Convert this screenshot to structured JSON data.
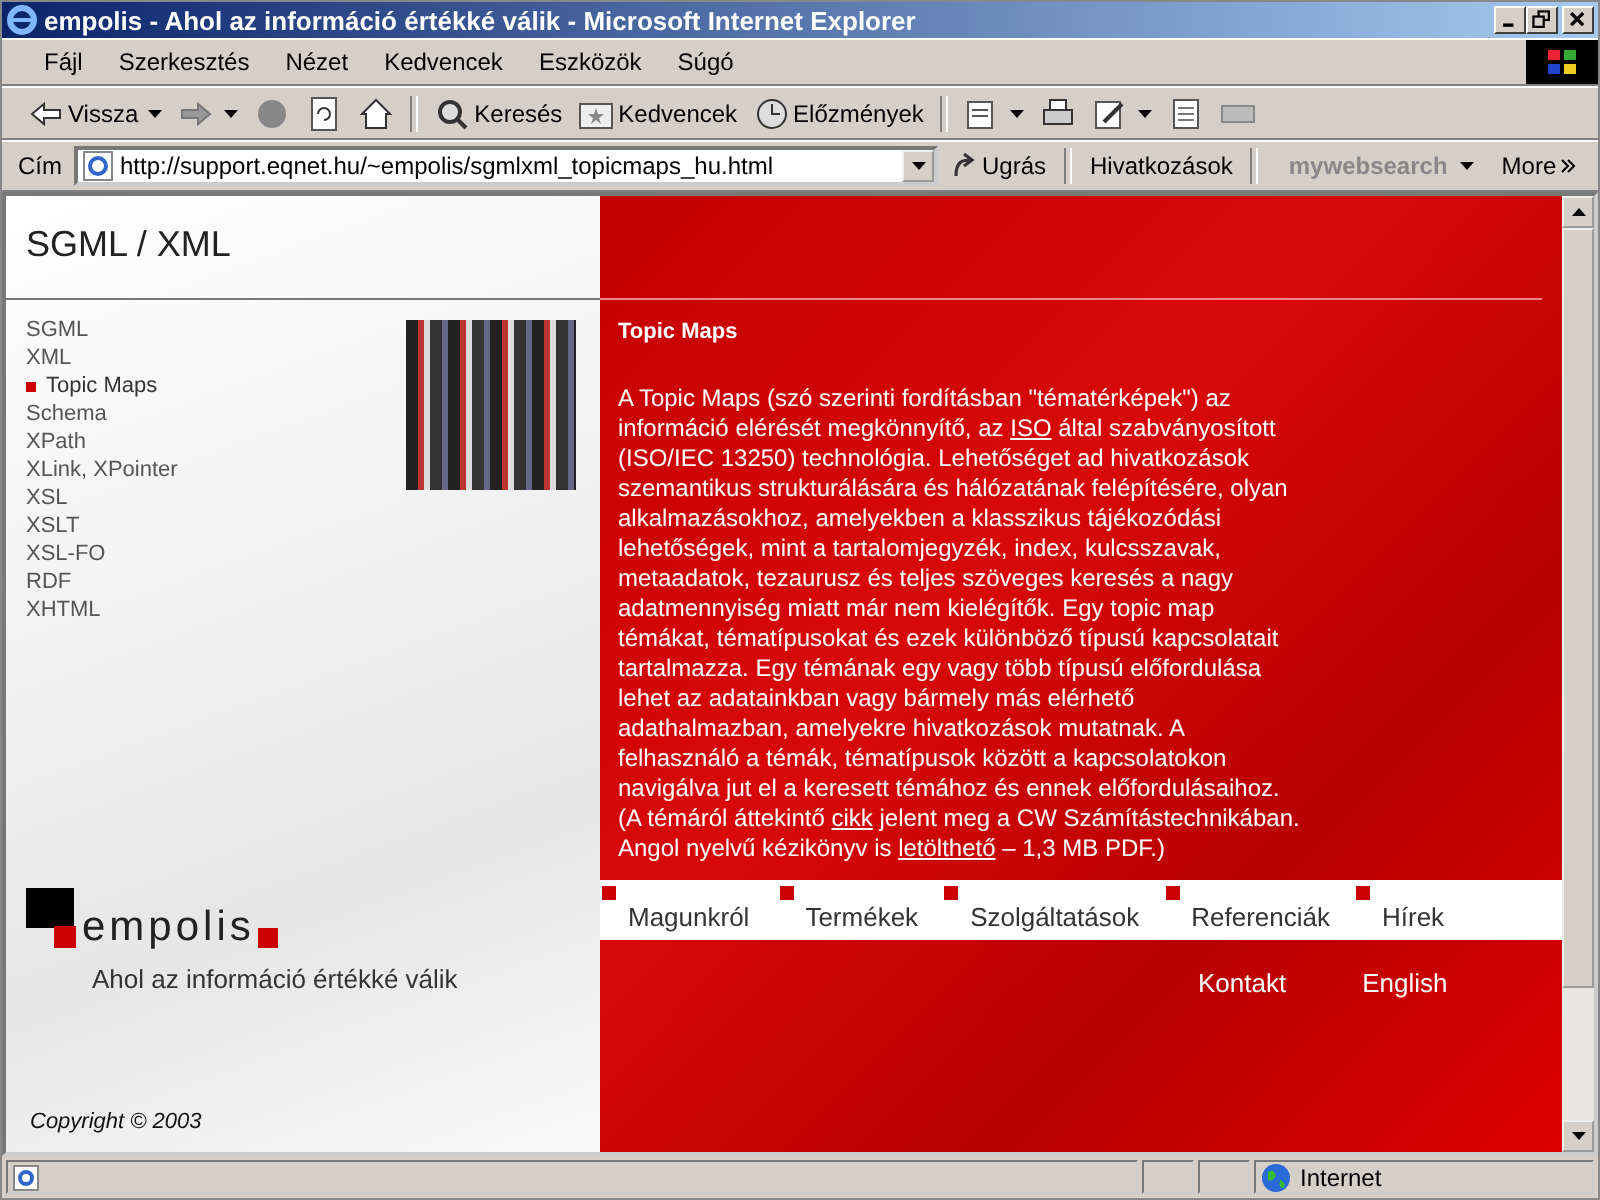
{
  "window": {
    "title": "empolis - Ahol az információ értékké válik - Microsoft Internet Explorer"
  },
  "menu": [
    "Fájl",
    "Szerkesztés",
    "Nézet",
    "Kedvencek",
    "Eszközök",
    "Súgó"
  ],
  "toolbar": [
    {
      "kind": "back",
      "label": "Vissza"
    },
    {
      "kind": "forward"
    },
    {
      "kind": "stop"
    },
    {
      "kind": "refresh"
    },
    {
      "kind": "home"
    },
    {
      "kind": "search",
      "label": "Keresés"
    },
    {
      "kind": "favorites",
      "label": "Kedvencek"
    },
    {
      "kind": "history",
      "label": "Előzmények"
    },
    {
      "kind": "mail"
    },
    {
      "kind": "print"
    },
    {
      "kind": "edit"
    },
    {
      "kind": "discuss"
    },
    {
      "kind": "messenger"
    }
  ],
  "address": {
    "label": "Cím",
    "value": "http://support.eqnet.hu/~empolis/sgmlxml_topicmaps_hu.html",
    "go": "Ugrás",
    "links": "Hivatkozások",
    "websearch": "my**web**search",
    "more": "More"
  },
  "page": {
    "heading": "SGML / XML",
    "nav": [
      {
        "label": "SGML",
        "selected": false
      },
      {
        "label": "XML",
        "selected": false
      },
      {
        "label": "Topic Maps",
        "selected": true
      },
      {
        "label": "Schema",
        "selected": false
      },
      {
        "label": "XPath",
        "selected": false
      },
      {
        "label": "XLink, XPointer",
        "selected": false
      },
      {
        "label": "XSL",
        "selected": false
      },
      {
        "label": "XSLT",
        "selected": false
      },
      {
        "label": "XSL-FO",
        "selected": false
      },
      {
        "label": "RDF",
        "selected": false
      },
      {
        "label": "XHTML",
        "selected": false
      }
    ],
    "article_title": "Topic Maps",
    "paragraphs": [
      [
        {
          "kind": "text",
          "text": "A Topic Maps (szó szerinti fordításban \"tématérképek\") az információ elérését megkönnyítő, az "
        },
        {
          "kind": "link",
          "text": "ISO"
        },
        {
          "kind": "text",
          "text": " által szabványosított (ISO/IEC 13250) technológia. Lehetőséget ad hivatkozások szemantikus strukturálására és hálózatának felépítésére, olyan alkalmazásokhoz, amelyekben a klasszikus tájékozódási lehetőségek, mint a tartalomjegyzék, index, kulcsszavak, metaadatok, tezaurusz és teljes szöveges keresés a nagy adatmennyiség miatt már nem kielégítők. Egy topic map témákat, tématípusokat és ezek különböző típusú kapcsolatait tartalmazza. Egy témának egy vagy több típusú előfordulása lehet az adatainkban vagy bármely más elérhető adathalmazban, amelyekre hivatkozások mutatnak. A felhasználó a témák, tématípusok között a kapcsolatokon navigálva jut el a keresett témához és ennek előfordulásaihoz."
        }
      ],
      [
        {
          "kind": "text",
          "text": "(A témáról áttekintő "
        },
        {
          "kind": "link",
          "text": "cikk"
        },
        {
          "kind": "text",
          "text": " jelent meg a CW Számítástechnikában. Angol nyelvű kézikönyv is "
        },
        {
          "kind": "link",
          "text": "letölthető"
        },
        {
          "kind": "text",
          "text": " – 1,3 MB PDF.)"
        }
      ]
    ],
    "main_nav": [
      "Magunkról",
      "Termékek",
      "Szolgáltatások",
      "Referenciák",
      "Hírek"
    ],
    "sub_nav": [
      "Kontakt",
      "English"
    ],
    "logo": "empolis",
    "tagline": "Ahol az információ értékké válik",
    "copyright": "Copyright © 2003"
  },
  "status_bar": {
    "zone": "Internet"
  }
}
